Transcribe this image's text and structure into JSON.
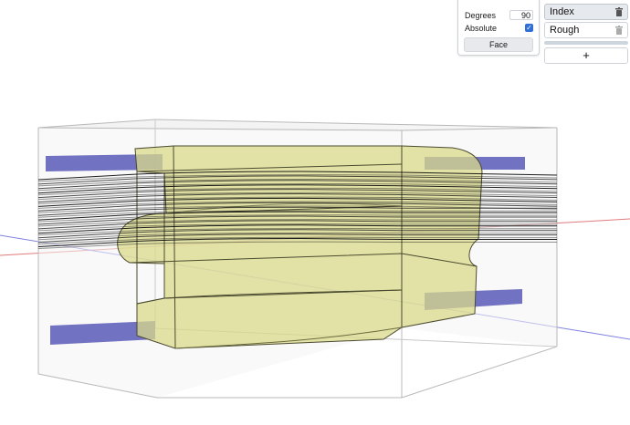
{
  "rotate_panel": {
    "degrees_label": "Degrees",
    "degrees_value": "90",
    "absolute_label": "Absolute",
    "absolute_checked": true,
    "face_button": "Face"
  },
  "layers_panel": {
    "layers": [
      {
        "label": "Index",
        "active": true,
        "icon": "trash-icon"
      },
      {
        "label": "Rough",
        "active": false,
        "icon": "trash-icon"
      }
    ],
    "add_button": "+"
  },
  "colors": {
    "accent": "#2f6fd6",
    "part_fill": "#d9d98a",
    "fixture_blocks": "#5a5ab8",
    "x_axis": "#e07a7a",
    "y_axis": "#8080e0"
  }
}
